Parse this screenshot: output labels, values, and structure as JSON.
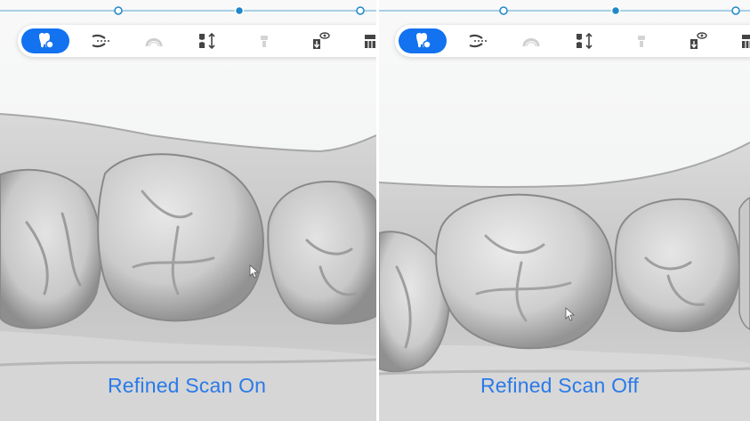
{
  "progress": {
    "current_step": 1,
    "accent_color": "#1e88c8"
  },
  "toolbar": {
    "active_color": "#1272f0",
    "tools": [
      {
        "icon": "tooth-scan-icon",
        "active": true
      },
      {
        "icon": "occlusion-icon",
        "active": false
      },
      {
        "icon": "arch-icon",
        "active": false
      },
      {
        "icon": "bite-align-icon",
        "active": false
      },
      {
        "icon": "single-tooth-icon",
        "active": false
      },
      {
        "icon": "tooth-view-icon",
        "active": false
      },
      {
        "icon": "jaw-icon",
        "active": false
      }
    ]
  },
  "panels": {
    "left": {
      "caption": "Refined Scan On"
    },
    "right": {
      "caption": "Refined Scan Off"
    }
  }
}
